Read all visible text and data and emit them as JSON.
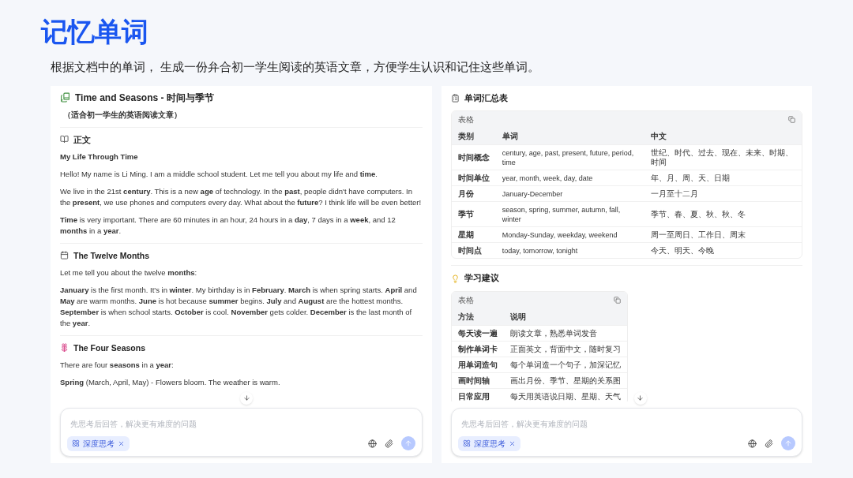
{
  "title": "记忆单词",
  "subtitle": "根据文档中的单词， 生成一份弁合初一学生阅读的英语文章，方便学生认识和记住这些单词。",
  "article": {
    "heading": "Time and Seasons - 时间与季节",
    "subheading": "（适合初一学生的英语阅读文章）",
    "sections": [
      {
        "heading": "正文",
        "title": "My Life Through Time",
        "paragraphs": [
          "Hello! My name is Li Ming. I am a middle school student. Let me tell you about my life and **time**.",
          "We live in the 21st **century**. This is a new **age** of technology. In the **past**, people didn't have computers. In the **present**, we use phones and computers every day. What about the **future**? I think life will be even better!",
          "**Time** is very important. There are 60 minutes in an hour, 24 hours in a **day**, 7 days in a **week**, and 12 **months** in a **year**."
        ]
      },
      {
        "heading": "The Twelve Months",
        "paragraphs": [
          "Let me tell you about the twelve **months**:",
          "**January** is the first month. It's in **winter**. My birthday is in **February**. **March** is when spring starts. **April** and **May** are warm months. **June** is hot because **summer** begins. **July** and **August** are the hottest months. **September** is when school starts. **October** is cool. **November** gets colder. **December** is the last month of the **year**."
        ]
      },
      {
        "heading": "The Four Seasons",
        "paragraphs": [
          "There are four **seasons** in a **year**:",
          "**Spring** (March, April, May) - Flowers bloom. The weather is warm."
        ]
      }
    ]
  },
  "summary": {
    "sections": [
      {
        "heading": "单词汇总表",
        "caption": "表格",
        "columns": [
          "类别",
          "单词",
          "中文"
        ],
        "rows": [
          [
            "时间概念",
            "century, age, past, present, future, period, time",
            "世纪、时代、过去、现在、未来、时期、时间"
          ],
          [
            "时间单位",
            "year, month, week, day, date",
            "年、月、周、天、日期"
          ],
          [
            "月份",
            "January-December",
            "一月至十二月"
          ],
          [
            "季节",
            "season, spring, summer, autumn, fall, winter",
            "季节、春、夏、秋、秋、冬"
          ],
          [
            "星期",
            "Monday-Sunday, weekday, weekend",
            "周一至周日、工作日、周末"
          ],
          [
            "时间点",
            "today, tomorrow, tonight",
            "今天、明天、今晚"
          ]
        ]
      },
      {
        "heading": "学习建议",
        "caption": "表格",
        "columns": [
          "方法",
          "说明"
        ],
        "rows": [
          [
            "每天读一遍",
            "朗读文章，熟悉单词发音"
          ],
          [
            "制作单词卡",
            "正面英文，背面中文，随时复习"
          ],
          [
            "用单词造句",
            "每个单词造一个句子，加深记忆"
          ],
          [
            "画时间轴",
            "画出月份、季节、星期的关系图"
          ],
          [
            "日常应用",
            "每天用英语说日期、星期、天气"
          ]
        ]
      }
    ]
  },
  "inputs": [
    {
      "placeholder": "先思考后回答，解决更有难度的问题",
      "chip": "深度思考"
    },
    {
      "placeholder": "先思考后回答，解决更有难度的问题",
      "chip": "深度思考"
    }
  ]
}
